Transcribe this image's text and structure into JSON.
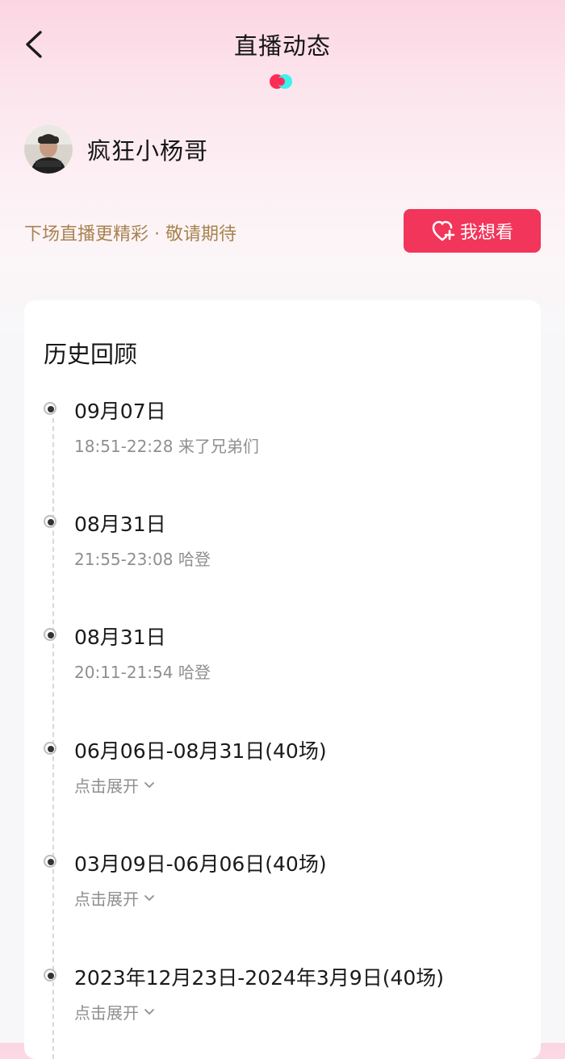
{
  "header": {
    "title": "直播动态",
    "back_icon": "chevron-left-icon",
    "logo_colors": [
      "#fe2c55",
      "#25f4ee"
    ]
  },
  "profile": {
    "name": "疯狂小杨哥",
    "avatar": "avatar-photo"
  },
  "notice": {
    "text": "下场直播更精彩 · 敬请期待"
  },
  "want_button": {
    "label": "我想看",
    "icon": "heart-plus-icon",
    "color": "#f2355a"
  },
  "history": {
    "title": "历史回顾",
    "items": [
      {
        "date": "09月07日",
        "detail": "18:51-22:28 来了兄弟们"
      },
      {
        "date": "08月31日",
        "detail": "21:55-23:08 哈登"
      },
      {
        "date": "08月31日",
        "detail": "20:11-21:54 哈登"
      },
      {
        "date": "06月06日-08月31日(40场)",
        "expand": "点击展开"
      },
      {
        "date": "03月09日-06月06日(40场)",
        "expand": "点击展开"
      },
      {
        "date": "2023年12月23日-2024年3月9日(40场)",
        "expand": "点击展开"
      }
    ]
  },
  "colors": {
    "accent": "#f2355a",
    "notice_text": "#a7834f",
    "muted_text": "#8f8f8f"
  }
}
